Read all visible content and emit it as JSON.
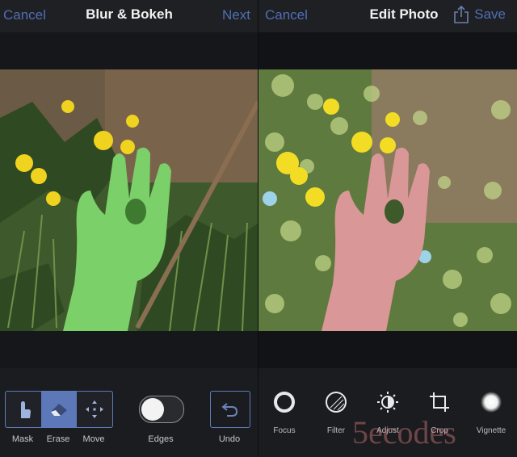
{
  "left": {
    "nav": {
      "cancel": "Cancel",
      "title": "Blur & Bokeh",
      "next": "Next"
    },
    "tools": {
      "mask": "Mask",
      "erase": "Erase",
      "move": "Move",
      "edges": "Edges",
      "undo": "Undo",
      "active": "Erase",
      "edges_on": false
    }
  },
  "right": {
    "nav": {
      "cancel": "Cancel",
      "title": "Edit Photo",
      "save": "Save"
    },
    "tools": [
      {
        "label": "Focus",
        "icon": "focus-ring-icon"
      },
      {
        "label": "Filter",
        "icon": "filter-icon"
      },
      {
        "label": "Adjust",
        "icon": "adjust-icon"
      },
      {
        "label": "Crop",
        "icon": "crop-icon"
      },
      {
        "label": "Vignette",
        "icon": "vignette-icon"
      }
    ]
  },
  "watermark": "5ecodes",
  "colors": {
    "accent": "#5c78b8",
    "link": "#4f6fb5",
    "mask_green": "#7bd06a"
  }
}
